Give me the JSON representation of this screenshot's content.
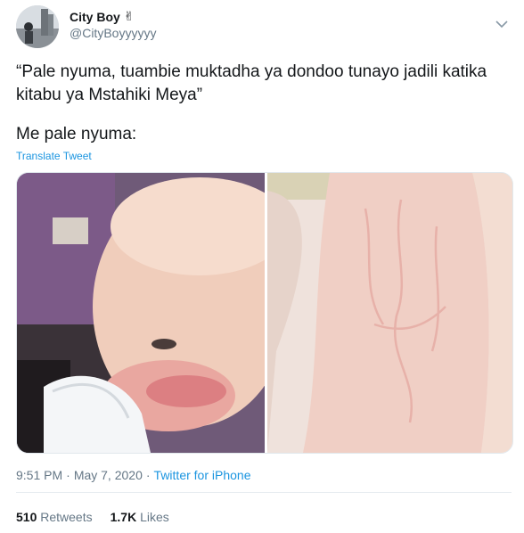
{
  "author": {
    "display_name": "City Boy",
    "handle": "@CityBoyyyyyy",
    "badge_emoji": "✌"
  },
  "tweet": {
    "text_line1": "“Pale nyuma, tuambie muktadha ya dondoo tunayo jadili katika",
    "text_line2": "kitabu ya Mstahiki Meya”",
    "text_line3": "Me pale nyuma:",
    "translate_label": "Translate Tweet"
  },
  "media": {
    "left_image_icon": "baby-photo",
    "right_image_icon": "skin-marks-photo"
  },
  "meta": {
    "time": "9:51 PM",
    "date": "May 7, 2020",
    "separator": "·",
    "source": "Twitter for iPhone"
  },
  "stats": {
    "retweets_count": "510",
    "retweets_label": "Retweets",
    "likes_count": "1.7K",
    "likes_label": "Likes"
  },
  "colors": {
    "link": "#1b95e0",
    "muted": "#657786",
    "text": "#14171a"
  }
}
